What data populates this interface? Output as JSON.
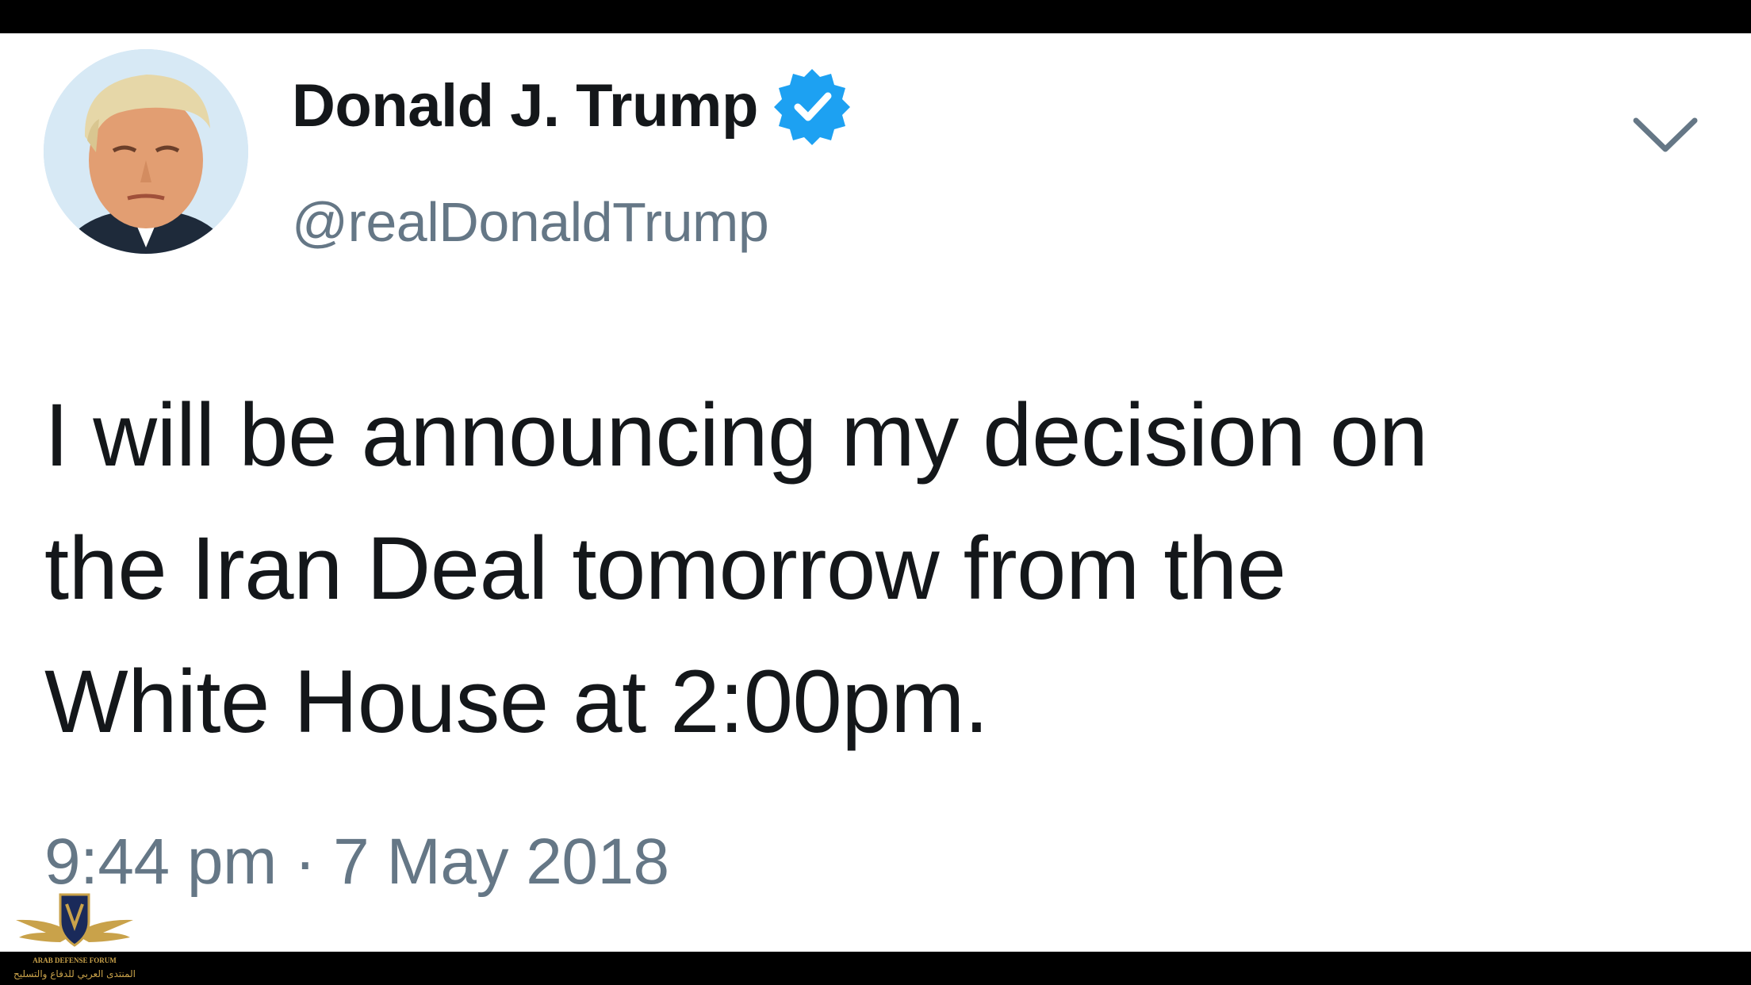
{
  "tweet": {
    "display_name": "Donald J. Trump",
    "handle": "@realDonaldTrump",
    "verified": true,
    "text_lines": [
      "I will be announcing my decision on",
      "the Iran Deal tomorrow from the",
      "White House at 2:00pm."
    ],
    "timestamp": "9:44 pm · 7 May 2018",
    "menu_icon": "chevron-down-icon",
    "verified_icon": "verified-badge-icon"
  },
  "colors": {
    "text_primary": "#14171a",
    "text_secondary": "#657786",
    "verified_blue": "#1da1f2",
    "background": "#ffffff",
    "frame": "#000000"
  },
  "watermark": {
    "lines": [
      "ARAB DEFENSE FORUM",
      "المنتدى العربي للدفاع والتسليح"
    ]
  }
}
